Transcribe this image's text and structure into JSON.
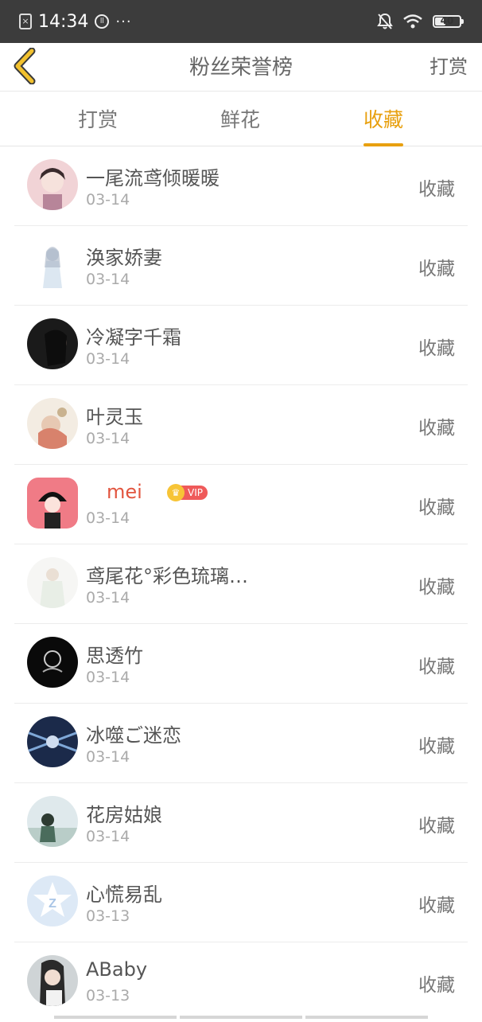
{
  "status_bar": {
    "time": "14:34",
    "sim_icon": "sim-icon",
    "ll_icon": "ll-badge-icon",
    "dots": "···",
    "battery": "40",
    "icons": [
      "bell-off-icon",
      "wifi-icon",
      "battery-icon"
    ]
  },
  "nav": {
    "title": "粉丝荣誉榜",
    "right_label": "打赏",
    "back_icon": "chevron-left-icon"
  },
  "tabs": [
    {
      "label": "打赏",
      "active": false
    },
    {
      "label": "鲜花",
      "active": false
    },
    {
      "label": "收藏",
      "active": true
    }
  ],
  "colors": {
    "accent": "#e8a00f",
    "vip_name": "#e2553f",
    "vip_badge": "#ef5a5a",
    "vip_crown": "#f7c436"
  },
  "list": [
    {
      "name": "一尾流鸢倾暖暖",
      "date": "03-14",
      "action": "收藏",
      "vip": false
    },
    {
      "name": "涣家娇妻",
      "date": "03-14",
      "action": "收藏",
      "vip": false
    },
    {
      "name": "冷凝字千霜",
      "date": "03-14",
      "action": "收藏",
      "vip": false
    },
    {
      "name": "叶灵玉",
      "date": "03-14",
      "action": "收藏",
      "vip": false
    },
    {
      "name": "mei",
      "date": "03-14",
      "action": "收藏",
      "vip": true,
      "vip_label": "VIP"
    },
    {
      "name": "鸢尾花°彩色琉璃…",
      "date": "03-14",
      "action": "收藏",
      "vip": false
    },
    {
      "name": "思透竹",
      "date": "03-14",
      "action": "收藏",
      "vip": false
    },
    {
      "name": "冰噬ご迷恋",
      "date": "03-14",
      "action": "收藏",
      "vip": false
    },
    {
      "name": "花房姑娘",
      "date": "03-14",
      "action": "收藏",
      "vip": false
    },
    {
      "name": "心慌易乱",
      "date": "03-13",
      "action": "收藏",
      "vip": false
    },
    {
      "name": "ABaby",
      "date": "03-13",
      "action": "收藏",
      "vip": false
    }
  ]
}
